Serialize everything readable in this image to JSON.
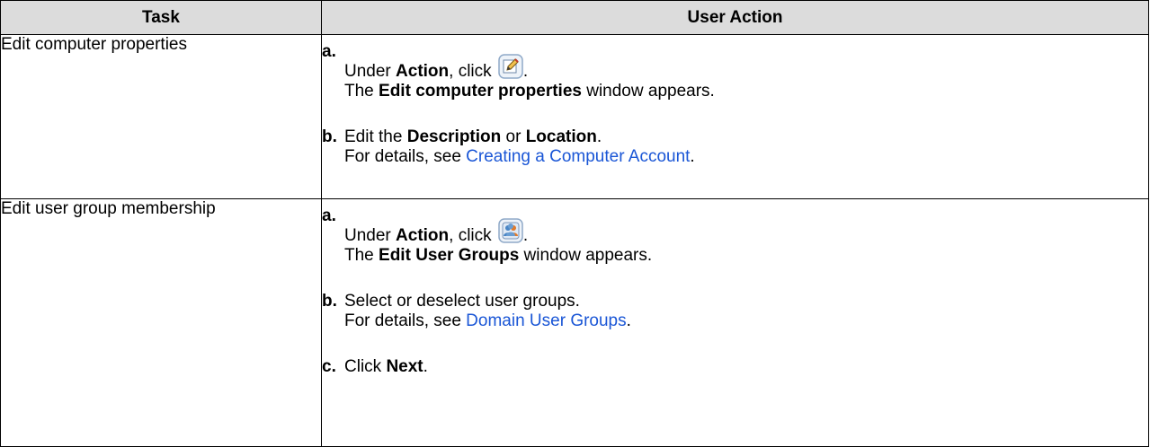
{
  "table": {
    "headers": {
      "task": "Task",
      "user_action": "User Action"
    },
    "rows": [
      {
        "task": "Edit computer properties",
        "steps": {
          "a": {
            "marker": "a.",
            "line1_pre": "Under ",
            "line1_bold": "Action",
            "line1_post": ", click",
            "line1_end": ".",
            "line2_pre": "The ",
            "line2_bold": "Edit computer properties",
            "line2_post": " window appears.",
            "icon": "edit-pencil-icon"
          },
          "b": {
            "marker": "b.",
            "line1_pre": "Edit the ",
            "line1_bold1": "Description",
            "line1_mid": " or ",
            "line1_bold2": "Location",
            "line1_end": ".",
            "line2_pre": "For details, see ",
            "line2_link": "Creating a Computer Account",
            "line2_end": "."
          }
        }
      },
      {
        "task": "Edit user group membership",
        "steps": {
          "a": {
            "marker": "a.",
            "line1_pre": "Under ",
            "line1_bold": "Action",
            "line1_post": ", click",
            "line1_end": ".",
            "line2_pre": "The ",
            "line2_bold": "Edit User Groups",
            "line2_post": " window appears.",
            "icon": "user-groups-icon"
          },
          "b": {
            "marker": "b.",
            "line1": "Select or deselect user groups.",
            "line2_pre": "For details, see ",
            "line2_link": "Domain User Groups",
            "line2_end": "."
          },
          "c": {
            "marker": "c.",
            "line1_pre": "Click ",
            "line1_bold": "Next",
            "line1_end": "."
          }
        }
      }
    ]
  },
  "colors": {
    "header_bg": "#dcdcdc",
    "border": "#000000",
    "link": "#1a56d6",
    "icon_frame": "#8fa9c8",
    "icon_bg": "#eef3f9"
  }
}
